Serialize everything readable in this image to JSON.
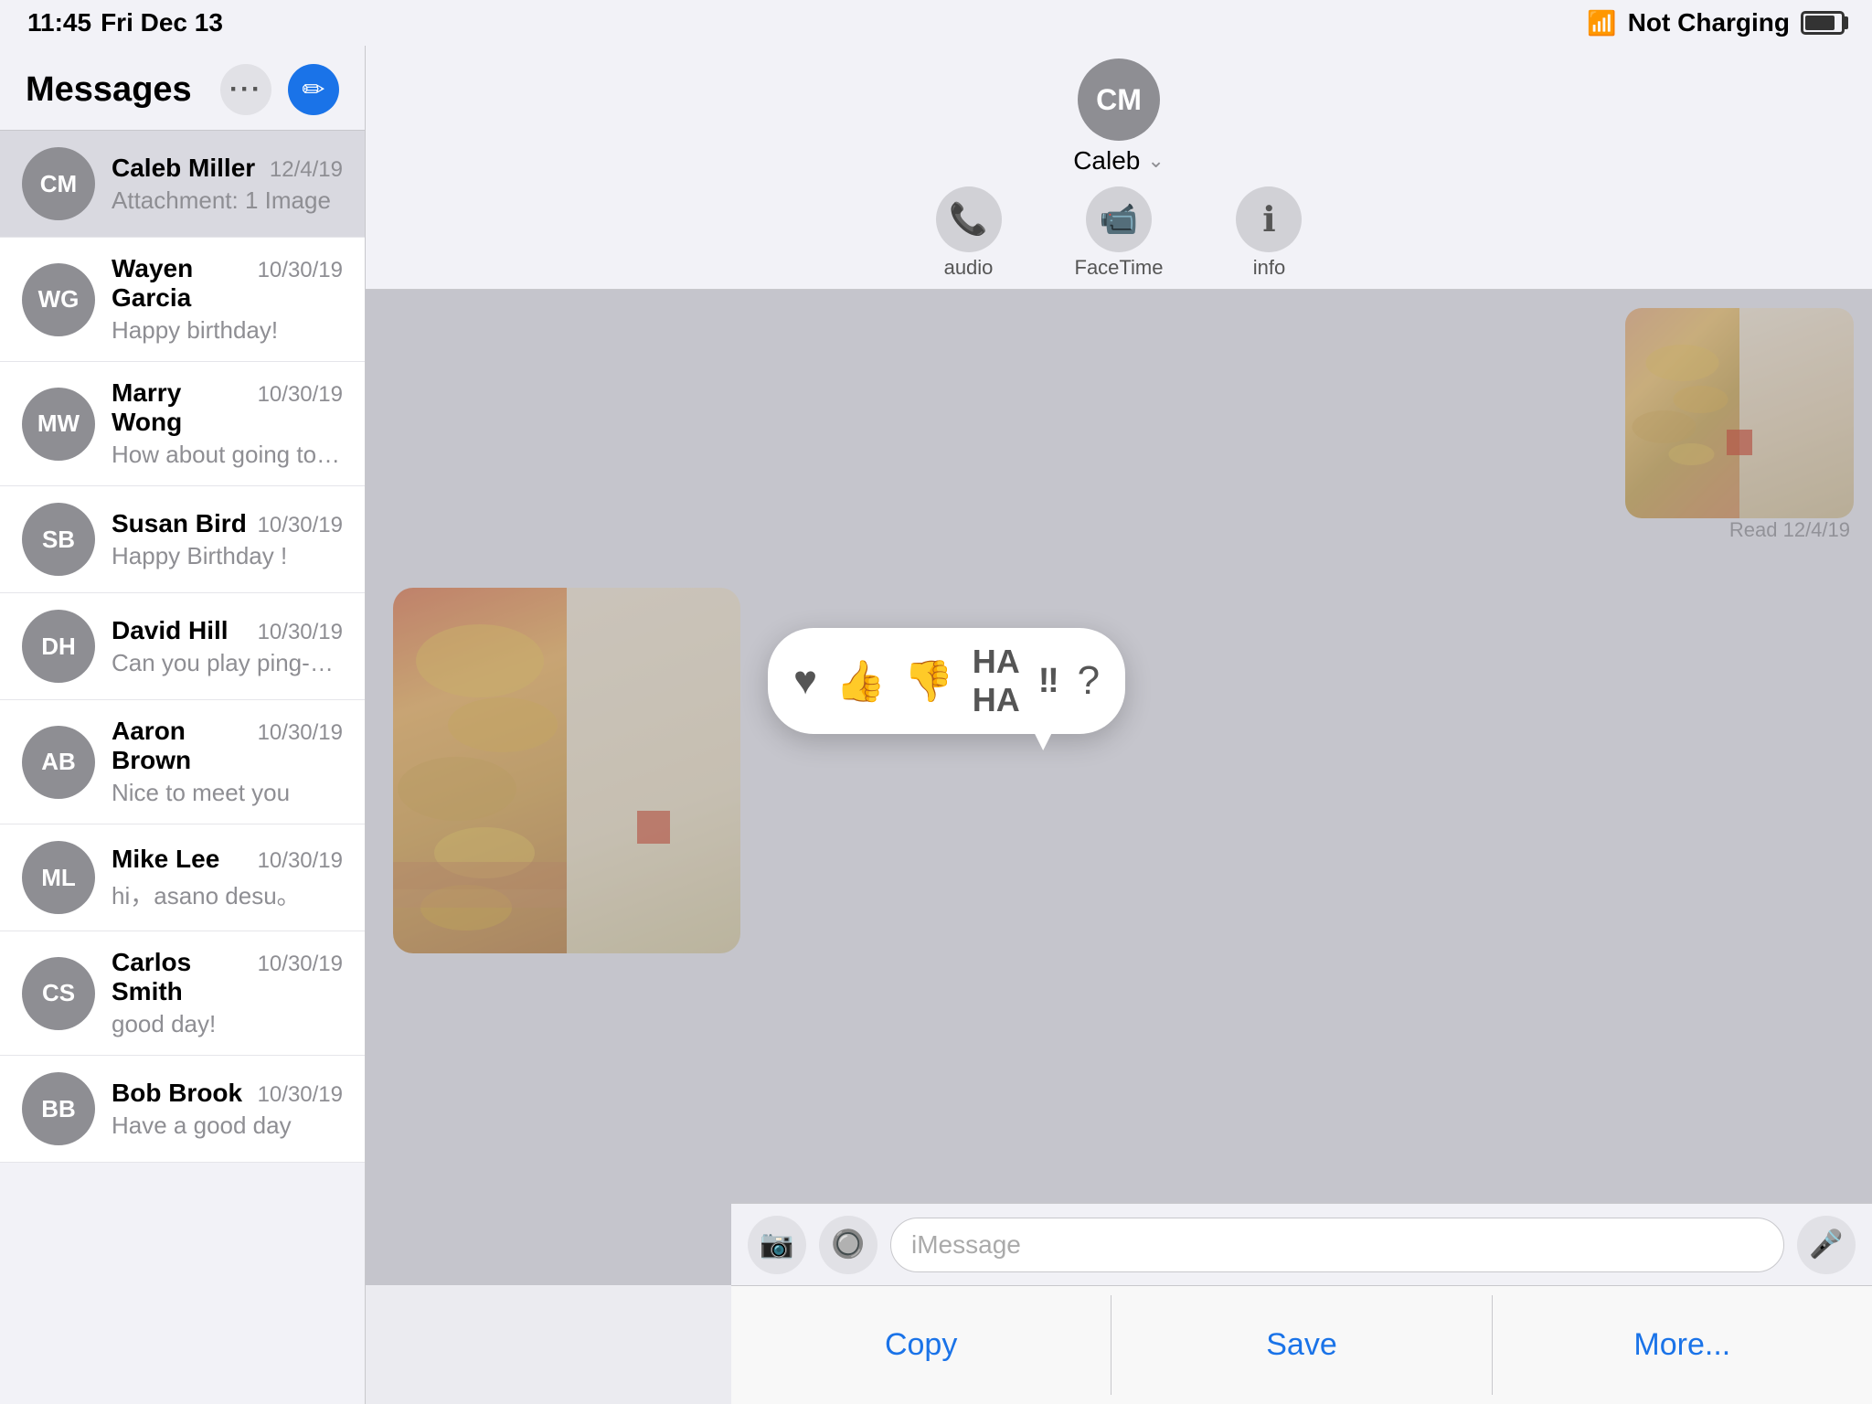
{
  "statusBar": {
    "time": "11:45",
    "day": "Fri Dec 13",
    "charging": "Not Charging"
  },
  "sidebar": {
    "title": "Messages",
    "moreLabel": "···",
    "composeLabel": "✏",
    "conversations": [
      {
        "id": "CM",
        "name": "Caleb Miller",
        "date": "12/4/19",
        "preview": "Attachment: 1 Image",
        "active": true
      },
      {
        "id": "WG",
        "name": "Wayen Garcia",
        "date": "10/30/19",
        "preview": "Happy birthday!"
      },
      {
        "id": "MW",
        "name": "Marry Wong",
        "date": "10/30/19",
        "preview": "How about going to pub today?"
      },
      {
        "id": "SB",
        "name": "Susan Bird",
        "date": "10/30/19",
        "preview": "Happy Birthday !"
      },
      {
        "id": "DH",
        "name": "David Hill",
        "date": "10/30/19",
        "preview": "Can you play ping-pong?"
      },
      {
        "id": "AB",
        "name": "Aaron Brown",
        "date": "10/30/19",
        "preview": "Nice to meet you"
      },
      {
        "id": "ML",
        "name": "Mike Lee",
        "date": "10/30/19",
        "preview": "hi，asano desu。"
      },
      {
        "id": "CS",
        "name": "Carlos Smith",
        "date": "10/30/19",
        "preview": "good day!"
      },
      {
        "id": "BB",
        "name": "Bob Brook",
        "date": "10/30/19",
        "preview": "Have a good day"
      }
    ]
  },
  "chat": {
    "contactInitials": "CM",
    "contactName": "Caleb",
    "actions": [
      {
        "id": "audio",
        "icon": "📞",
        "label": "audio"
      },
      {
        "id": "facetime",
        "icon": "📹",
        "label": "FaceTime"
      },
      {
        "id": "info",
        "icon": "ℹ",
        "label": "info"
      }
    ],
    "readTimestamp": "Read 12/4/19"
  },
  "tapback": {
    "reactions": [
      "♥",
      "👍",
      "👎",
      "😄",
      "‼",
      "?"
    ]
  },
  "inputBar": {
    "placeholder": "iMessage"
  },
  "actionSheet": {
    "copy": "Copy",
    "save": "Save",
    "more": "More..."
  }
}
